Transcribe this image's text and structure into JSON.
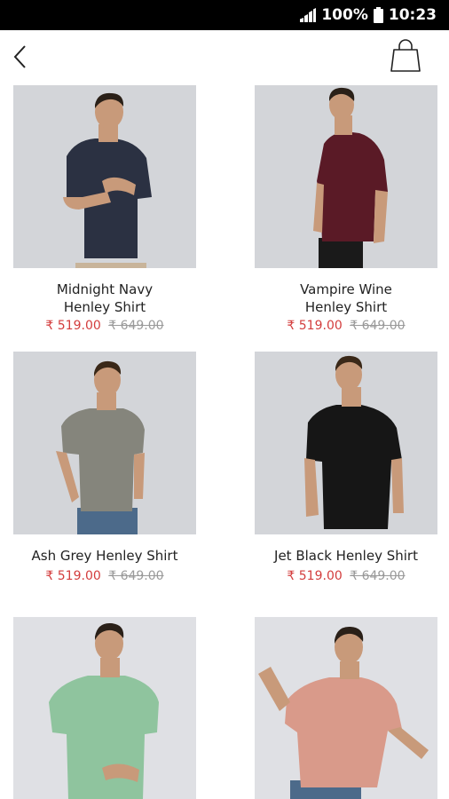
{
  "status_bar": {
    "battery": "100%",
    "time": "10:23"
  },
  "header": {
    "back_icon": "chevron-left-icon",
    "cart_icon": "shopping-bag-icon"
  },
  "products": [
    {
      "name_line1": "Midnight Navy",
      "name_line2": "Henley Shirt",
      "price": "₹ 519.00",
      "mrp": "₹ 649.00",
      "shirt_color": "#2b3142"
    },
    {
      "name_line1": "Vampire Wine",
      "name_line2": "Henley Shirt",
      "price": "₹ 519.00",
      "mrp": "₹ 649.00",
      "shirt_color": "#5a1a26"
    },
    {
      "name_line1": "Ash Grey Henley Shirt",
      "name_line2": "",
      "price": "₹ 519.00",
      "mrp": "₹ 649.00",
      "shirt_color": "#85857c"
    },
    {
      "name_line1": "Jet Black Henley Shirt",
      "name_line2": "",
      "price": "₹ 519.00",
      "mrp": "₹ 649.00",
      "shirt_color": "#161616"
    },
    {
      "name_line1": "",
      "name_line2": "",
      "price": "",
      "mrp": "",
      "shirt_color": "#8fc49e"
    },
    {
      "name_line1": "",
      "name_line2": "",
      "price": "",
      "mrp": "",
      "shirt_color": "#d99a8a"
    }
  ]
}
